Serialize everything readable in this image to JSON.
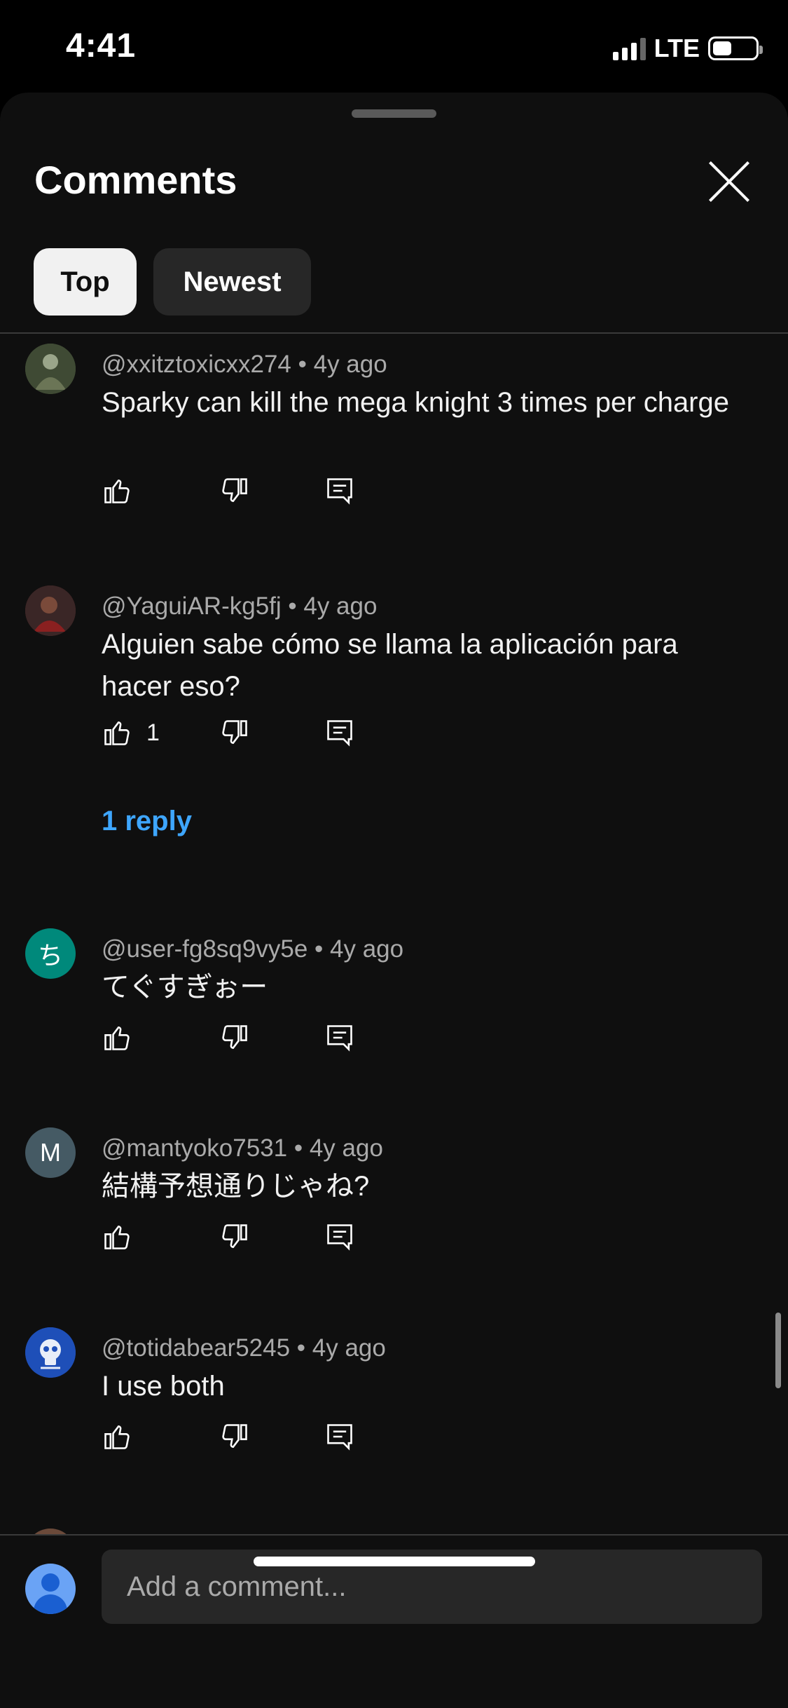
{
  "status_bar": {
    "time": "4:41",
    "network": "LTE",
    "battery_level": 0.45
  },
  "sheet": {
    "title": "Comments"
  },
  "filters": [
    {
      "label": "Top",
      "selected": true
    },
    {
      "label": "Newest",
      "selected": false
    }
  ],
  "comments": [
    {
      "author": "@xxitztoxicxx274",
      "time": "4y ago",
      "text": "Sparky can kill the mega knight 3 times per charge",
      "likes": "",
      "avatar_letter": "",
      "avatar_color": "#4a5a3a"
    },
    {
      "author": "@YaguiAR-kg5fj",
      "time": "4y ago",
      "text": "Alguien sabe cómo se llama la aplicación para hacer eso?",
      "likes": "1",
      "replies": "1 reply",
      "avatar_letter": "",
      "avatar_color": "#5a2a2a"
    },
    {
      "author": "@user-fg8sq9vy5e",
      "time": "4y ago",
      "text": "てぐすぎぉー",
      "likes": "",
      "avatar_letter": "ち",
      "avatar_color": "#00897b"
    },
    {
      "author": "@mantyoko7531",
      "time": "4y ago",
      "text": "結構予想通りじゃね?",
      "likes": "",
      "avatar_letter": "M",
      "avatar_color": "#455a64"
    },
    {
      "author": "@totidabear5245",
      "time": "4y ago",
      "text": "I use both",
      "likes": "",
      "avatar_letter": "",
      "avatar_color": "#1e4fb8"
    }
  ],
  "add_comment": {
    "placeholder": "Add a comment..."
  },
  "colors": {
    "background": "#0f0f0f",
    "link": "#3ea6ff",
    "chip_selected": "#f1f1f1",
    "chip": "#272727"
  },
  "icons": [
    "thumb-up-icon",
    "thumb-down-icon",
    "reply-icon",
    "close-icon"
  ]
}
